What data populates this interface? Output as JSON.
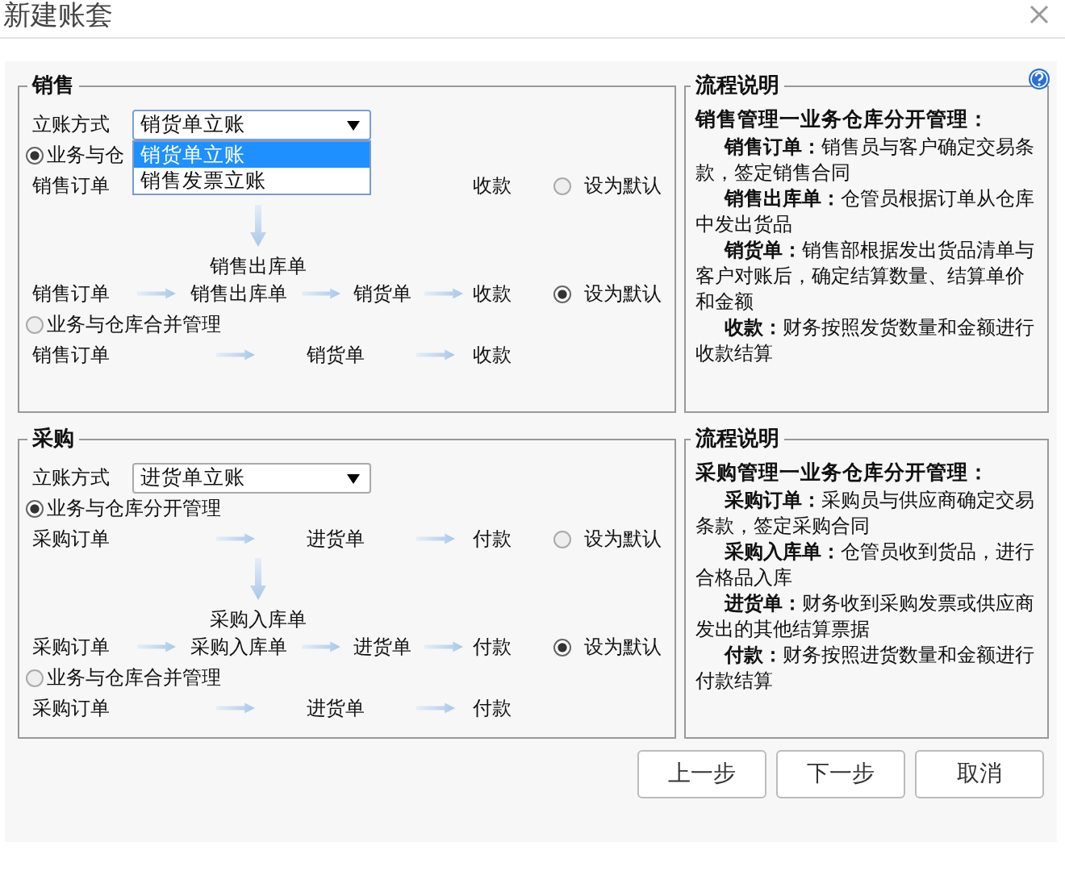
{
  "window": {
    "title": "新建账套"
  },
  "sections": [
    {
      "title": "销售",
      "posting": {
        "label": "立账方式",
        "value": "销货单立账",
        "expanded": true,
        "options": [
          {
            "text": "销货单立账",
            "selected": true
          },
          {
            "text": "销售发票立账",
            "selected": false
          }
        ]
      },
      "lines": [
        {
          "kind": "mode",
          "label": "业务与仓",
          "selected": true
        },
        {
          "kind": "flow",
          "cells": [
            {
              "kind": "step",
              "text": "销售订单"
            },
            {
              "kind": "blank"
            },
            {
              "kind": "blank"
            },
            {
              "kind": "blank"
            },
            {
              "kind": "step",
              "text": "收款"
            }
          ],
          "default": {
            "label": "设为默认",
            "selected": false
          }
        },
        {
          "kind": "branch",
          "text": "销售出库单"
        },
        {
          "kind": "flow",
          "cells": [
            {
              "kind": "step",
              "text": "销售订单"
            },
            {
              "kind": "arrow"
            },
            {
              "kind": "step",
              "text": "销售出库单"
            },
            {
              "kind": "arrow"
            },
            {
              "kind": "step",
              "text": "销货单"
            },
            {
              "kind": "arrow"
            },
            {
              "kind": "step",
              "text": "收款"
            }
          ],
          "default": {
            "label": "设为默认",
            "selected": true
          }
        },
        {
          "kind": "mode",
          "label": "业务与仓库合并管理",
          "selected": false
        },
        {
          "kind": "flow",
          "cells": [
            {
              "kind": "step",
              "text": "销售订单"
            },
            {
              "kind": "arrow"
            },
            {
              "kind": "step",
              "text": "销货单"
            },
            {
              "kind": "arrow"
            },
            {
              "kind": "step",
              "text": "收款"
            }
          ]
        }
      ],
      "help": {
        "title": "流程说明",
        "heading": "销售管理一业务仓库分开管理：",
        "entries": [
          "**销售订单：**销售员与客户确定交易条款，签定销售合同",
          "**销售出库单：**仓管员根据订单从仓库中发出货品",
          "**销货单：**销售部根据发出货品清单与客户对账后，确定结算数量、结算单价和金额",
          "**收款：**财务按照发货数量和金额进行收款结算"
        ]
      }
    },
    {
      "title": "采购",
      "posting": {
        "label": "立账方式",
        "value": "进货单立账",
        "expanded": false
      },
      "lines": [
        {
          "kind": "mode",
          "label": "业务与仓库分开管理",
          "selected": true
        },
        {
          "kind": "flow",
          "cells": [
            {
              "kind": "step",
              "text": "采购订单"
            },
            {
              "kind": "arrow"
            },
            {
              "kind": "step",
              "text": "进货单"
            },
            {
              "kind": "arrow"
            },
            {
              "kind": "step",
              "text": "付款"
            }
          ],
          "default": {
            "label": "设为默认",
            "selected": false
          }
        },
        {
          "kind": "branch",
          "text": "采购入库单"
        },
        {
          "kind": "flow",
          "cells": [
            {
              "kind": "step",
              "text": "采购订单"
            },
            {
              "kind": "arrow"
            },
            {
              "kind": "step",
              "text": "采购入库单"
            },
            {
              "kind": "arrow"
            },
            {
              "kind": "step",
              "text": "进货单"
            },
            {
              "kind": "arrow"
            },
            {
              "kind": "step",
              "text": "付款"
            }
          ],
          "default": {
            "label": "设为默认",
            "selected": true
          }
        },
        {
          "kind": "mode",
          "label": "业务与仓库合并管理",
          "selected": false
        },
        {
          "kind": "flow",
          "cells": [
            {
              "kind": "step",
              "text": "采购订单"
            },
            {
              "kind": "arrow"
            },
            {
              "kind": "step",
              "text": "进货单"
            },
            {
              "kind": "arrow"
            },
            {
              "kind": "step",
              "text": "付款"
            }
          ]
        }
      ],
      "help": {
        "title": "流程说明",
        "heading": "采购管理一业务仓库分开管理：",
        "entries": [
          "**采购订单：**采购员与供应商确定交易条款，签定采购合同",
          "**采购入库单：**仓管员收到货品，进行合格品入库",
          "**进货单：**财务收到采购发票或供应商发出的其他结算票据",
          "**付款：**财务按照进货数量和金额进行付款结算"
        ]
      }
    }
  ],
  "buttons": [
    "上一步",
    "下一步",
    "取消"
  ]
}
